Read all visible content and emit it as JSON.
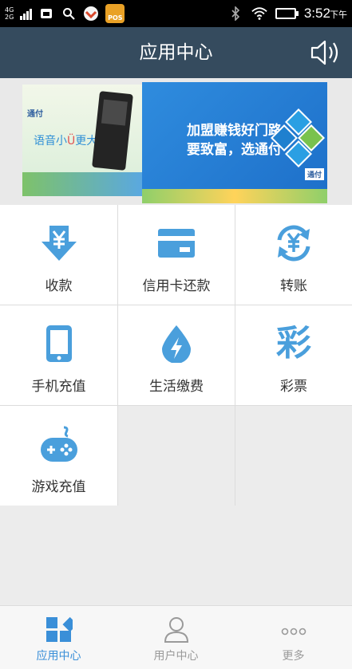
{
  "status_bar": {
    "network_top": "4G",
    "network_bottom": "2G",
    "pos_badge": "POS",
    "time": "3:52",
    "ampm": "下午"
  },
  "header": {
    "title": "应用中心",
    "speaker_icon": "speaker-icon"
  },
  "banner": {
    "left_brand": "通付",
    "left_slogan_a": "语音小",
    "left_slogan_b": "Ü",
    "left_slogan_c": "更大",
    "ad_line1": "加盟赚钱好门路",
    "ad_line2": "要致富，选通付",
    "right_brand": "通付"
  },
  "services": [
    {
      "label": "收款",
      "icon": "download-yen-icon"
    },
    {
      "label": "信用卡还款",
      "icon": "credit-card-icon"
    },
    {
      "label": "转账",
      "icon": "yen-transfer-icon"
    },
    {
      "label": "手机充值",
      "icon": "mobile-phone-icon"
    },
    {
      "label": "生活缴费",
      "icon": "water-drop-lightning-icon"
    },
    {
      "label": "彩票",
      "icon": "lottery-icon"
    },
    {
      "label": "游戏充值",
      "icon": "gamepad-icon"
    }
  ],
  "nav": {
    "items": [
      {
        "label": "应用中心",
        "icon": "app-grid-icon",
        "active": true
      },
      {
        "label": "用户中心",
        "icon": "user-icon",
        "active": false
      },
      {
        "label": "更多",
        "icon": "more-dots-icon",
        "active": false
      }
    ]
  },
  "colors": {
    "header_bg": "#354b5e",
    "icon_blue": "#4a9fdc",
    "nav_active": "#3a8fd8"
  }
}
